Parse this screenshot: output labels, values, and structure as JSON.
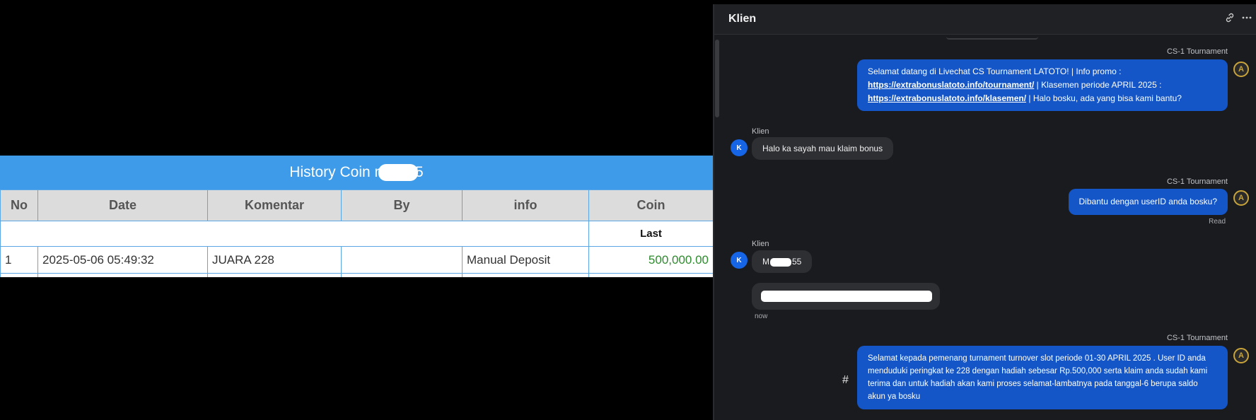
{
  "history": {
    "title_prefix": "History Coin m",
    "title_suffix": "5",
    "columns": [
      "No",
      "Date",
      "Komentar",
      "By",
      "info",
      "Coin"
    ],
    "subheader_last": "Last",
    "rows": [
      {
        "no": "1",
        "date": "2025-05-06 05:49:32",
        "komentar": "JUARA 228",
        "by": "",
        "info": "Manual Deposit",
        "coin": "500,000.00"
      }
    ]
  },
  "chat": {
    "title": "Klien",
    "link_icon": "link-icon",
    "more_icon": "more-icon",
    "messages": [
      {
        "sender": "CS-1 Tournament",
        "lines": [
          {
            "pre": "Selamat datang di Livechat CS Tournament LATOTO! | Info promo :",
            "link": "",
            "post": ""
          },
          {
            "pre": "",
            "link": "https://extrabonuslatoto.info/tournament/",
            "post": " | Klasemen periode APRIL 2025 :"
          },
          {
            "pre": "",
            "link": "https://extrabonuslatoto.info/klasemen/",
            "post": " | Halo bosku, ada yang bisa kami bantu?"
          }
        ]
      },
      {
        "sender": "Klien",
        "avatar": "K",
        "text": "Halo ka sayah mau klaim bonus"
      },
      {
        "sender": "CS-1 Tournament",
        "text": "Dibantu dengan userID anda bosku?",
        "status": "Read"
      },
      {
        "sender": "Klien",
        "avatar": "K",
        "text_prefix": "M",
        "text_suffix": "55",
        "time": "now"
      },
      {
        "sender": "CS-1 Tournament",
        "text": "Selamat kepada pemenang turnament turnover slot periode 01-30 APRIL 2025 . User ID anda menduduki peringkat ke 228 dengan hadiah sebesar Rp.500,000 serta klaim anda sudah kami terima dan untuk hadiah akan kami proses selamat-lambatnya pada tanggal-6 berupa saldo akun ya bosku",
        "action_glyph": "#"
      }
    ]
  }
}
